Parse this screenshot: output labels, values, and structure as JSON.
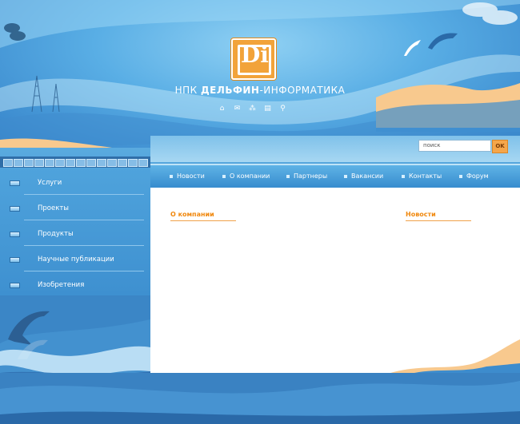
{
  "header": {
    "logo_letters": "Di",
    "brand_prefix": "НПК ",
    "brand_bold": "ДЕЛЬФИН",
    "brand_suffix": "-ИНФОРМАТИКА",
    "icons": [
      "home-icon",
      "mail-icon",
      "sitemap-icon",
      "print-icon",
      "search-icon"
    ]
  },
  "search": {
    "placeholder": "поиск",
    "value": "поиск",
    "button_label": "OK"
  },
  "topnav": {
    "items": [
      {
        "label": "Новости"
      },
      {
        "label": "О компании"
      },
      {
        "label": "Партнеры"
      },
      {
        "label": "Вакансии"
      },
      {
        "label": "Контакты"
      },
      {
        "label": "Форум"
      }
    ]
  },
  "sidebar": {
    "items": [
      {
        "label": "Услуги"
      },
      {
        "label": "Проекты"
      },
      {
        "label": "Продукты"
      },
      {
        "label": "Научные публикации"
      },
      {
        "label": "Изобретения"
      }
    ]
  },
  "content": {
    "about_heading": "О компании",
    "news_heading": "Новости"
  },
  "colors": {
    "accent_orange": "#f0880e",
    "logo_orange": "#f2a33a",
    "nav_blue": "#3489cc",
    "sand": "#f8c98e"
  }
}
